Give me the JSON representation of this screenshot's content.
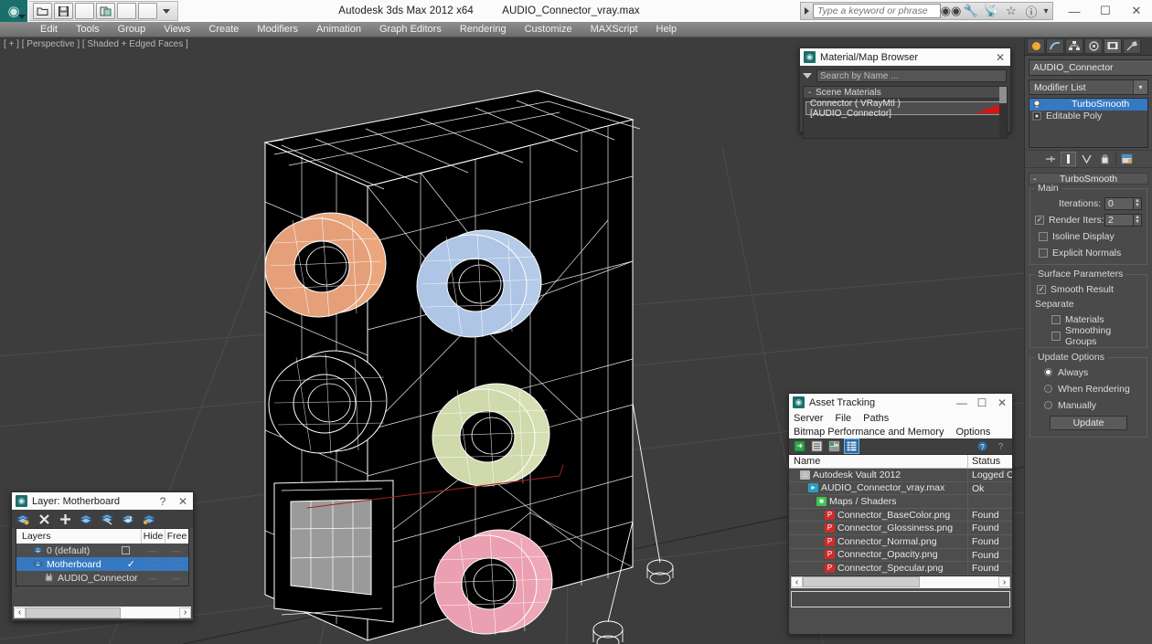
{
  "titlebar": {
    "app_title": "Autodesk 3ds Max  2012 x64",
    "file_name": "AUDIO_Connector_vray.max",
    "search_placeholder": "Type a keyword or phrase",
    "quick_access": [
      "open-icon",
      "save-icon",
      "undo-icon",
      "redo-icon",
      "render-icon",
      "renderframe-icon"
    ],
    "info_icons": [
      "binoculars-icon",
      "wrench-icon",
      "satellite-icon",
      "star-icon",
      "help-icon"
    ],
    "window_controls": {
      "minimize": "—",
      "maximize": "☐",
      "close": "✕"
    }
  },
  "menubar": {
    "items": [
      "Edit",
      "Tools",
      "Group",
      "Views",
      "Create",
      "Modifiers",
      "Animation",
      "Graph Editors",
      "Rendering",
      "Customize",
      "MAXScript",
      "Help"
    ]
  },
  "viewport": {
    "label": "[ + ] [ Perspective ] [ Shaded + Edged Faces ]",
    "background": "#3d3d3d",
    "object_fill": "#000000",
    "wire_color": "#ffffff",
    "connector_colors": [
      "#eaa77e",
      "#b6cbe8",
      "#d6dfb4",
      "#efa8b8",
      "#a8a8a8"
    ]
  },
  "material_browser": {
    "title": "Material/Map Browser",
    "close": "✕",
    "search_value": "Search by Name ...",
    "group_label": "Scene Materials",
    "group_collapse": "-",
    "material_name": "Connector  ( VRayMtl )  [AUDIO_Connector]",
    "swatch_color": "#d81212"
  },
  "asset_tracking": {
    "title": "Asset Tracking",
    "window_controls": {
      "minimize": "—",
      "maximize": "☐",
      "close": "✕"
    },
    "menu_row1": [
      "Server",
      "File",
      "Paths"
    ],
    "menu_row2": [
      "Bitmap Performance and Memory",
      "Options"
    ],
    "toolbar_icons": [
      "refresh-icon",
      "list-icon",
      "detail-icon",
      "grid-icon"
    ],
    "toolbar_right_icons": [
      "help-pin-icon",
      "help-icon"
    ],
    "columns": [
      "Name",
      "Status"
    ],
    "rows": [
      {
        "name": "Autodesk Vault 2012",
        "status": "Logged Ou",
        "indent": 1,
        "icon": "vault-icon",
        "icon_color": "#b8b8b8"
      },
      {
        "name": "AUDIO_Connector_vray.max",
        "status": "Ok",
        "indent": 2,
        "icon": "max-file-icon",
        "icon_color": "#2c9ec4"
      },
      {
        "name": "Maps / Shaders",
        "status": "",
        "indent": 3,
        "icon": "maps-icon",
        "icon_color": "#3cc44e"
      },
      {
        "name": "Connector_BaseColor.png",
        "status": "Found",
        "indent": 4,
        "icon": "png-icon",
        "icon_color": "#cf2b2b"
      },
      {
        "name": "Connector_Glossiness.png",
        "status": "Found",
        "indent": 4,
        "icon": "png-icon",
        "icon_color": "#cf2b2b"
      },
      {
        "name": "Connector_Normal.png",
        "status": "Found",
        "indent": 4,
        "icon": "png-icon",
        "icon_color": "#cf2b2b"
      },
      {
        "name": "Connector_Opacity.png",
        "status": "Found",
        "indent": 4,
        "icon": "png-icon",
        "icon_color": "#cf2b2b"
      },
      {
        "name": "Connector_Specular.png",
        "status": "Found",
        "indent": 4,
        "icon": "png-icon",
        "icon_color": "#cf2b2b"
      }
    ],
    "scroll_left": "‹",
    "scroll_right": "›"
  },
  "layer_explorer": {
    "title": "Layer: Motherboard",
    "help": "?",
    "close": "✕",
    "toolbar_icons": [
      "new-layer-icon",
      "delete-layer-icon",
      "add-layer-icon",
      "select-objects-icon",
      "select-highlight-icon",
      "add-selection-icon",
      "layer-props-icon"
    ],
    "columns": [
      "Layers",
      "Hide",
      "Free"
    ],
    "rows": [
      {
        "name": "0 (default)",
        "indent": 1,
        "selected": false,
        "has_checkbox": true,
        "checked": false,
        "icon": "layer-icon"
      },
      {
        "name": "Motherboard",
        "indent": 1,
        "selected": true,
        "has_checkbox": false,
        "checked": true,
        "icon": "layer-icon"
      },
      {
        "name": "AUDIO_Connector",
        "indent": 2,
        "selected": false,
        "has_checkbox": false,
        "checked": false,
        "icon": "object-icon"
      }
    ],
    "scroll_left": "‹",
    "scroll_right": "›"
  },
  "command_panel": {
    "tabs": [
      "create-tab",
      "modify-tab",
      "hierarchy-tab",
      "motion-tab",
      "display-tab",
      "utilities-tab"
    ],
    "selected_tab_index": 4,
    "object_name": "AUDIO_Connector",
    "object_color": "#8ab6dd",
    "modifier_list_label": "Modifier List",
    "dropdown_caret": "∨",
    "stack": [
      {
        "label": "TurboSmooth",
        "selected": true
      },
      {
        "label": "Editable Poly",
        "selected": false
      }
    ],
    "stack_tools": [
      "pin-stack-icon",
      "show-end-result-icon",
      "make-unique-icon",
      "remove-modifier-icon",
      "configure-sets-icon"
    ],
    "rollout": {
      "title": "TurboSmooth",
      "collapse": "-",
      "main_group": "Main",
      "iterations_label": "Iterations:",
      "iterations_value": "0",
      "render_iters_label": "Render Iters:",
      "render_iters_value": "2",
      "render_iters_checked": true,
      "isoline_label": "Isoline Display",
      "isoline_checked": false,
      "explicit_label": "Explicit Normals",
      "explicit_checked": false,
      "surface_group": "Surface Parameters",
      "smooth_result_label": "Smooth Result",
      "smooth_result_checked": true,
      "separate_label": "Separate",
      "materials_label": "Materials",
      "materials_checked": false,
      "smoothing_groups_label": "Smoothing Groups",
      "smoothing_groups_checked": false,
      "update_group": "Update Options",
      "update_options": [
        "Always",
        "When Rendering",
        "Manually"
      ],
      "update_selected_index": 0,
      "update_button": "Update"
    }
  }
}
